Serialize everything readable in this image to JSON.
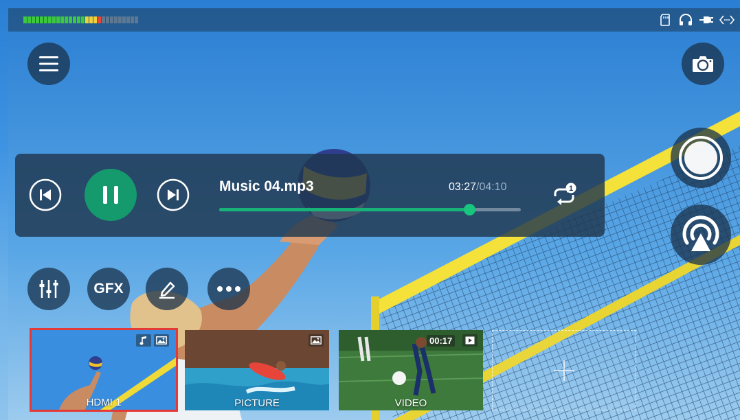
{
  "status_bar": {
    "audio_meter": {
      "level_fraction": 0.68,
      "colors": {
        "green": "#3ec83e",
        "yellow": "#f2d23a",
        "red": "#e8463a",
        "off": "#5f7891"
      }
    },
    "icons": [
      "sd-card-icon",
      "headphones-icon",
      "power-plug-icon",
      "network-arrows-icon"
    ]
  },
  "buttons": {
    "menu": "menu-icon",
    "camera": "camera-icon",
    "record": "record-icon",
    "live": "live-broadcast-icon",
    "mixer": "mixer-icon",
    "gfx_label": "GFX",
    "annotate": "pen-icon",
    "more": "more-dots-icon"
  },
  "music_player": {
    "title": "Music 04.mp3",
    "current_time": "03:27",
    "separator": "/",
    "total_time": "04:10",
    "progress_fraction": 0.829,
    "repeat_count": "1",
    "accent_color": "#149a6c"
  },
  "sources": [
    {
      "label": "HDMI 1",
      "selected": true,
      "badges": [
        "music-note-icon",
        "image-icon"
      ]
    },
    {
      "label": "PICTURE",
      "selected": false,
      "badges": [
        "image-icon"
      ]
    },
    {
      "label": "VIDEO",
      "selected": false,
      "duration": "00:17",
      "badges": [
        "play-icon"
      ]
    },
    {
      "label": "",
      "kind": "add",
      "icon": "plus-icon"
    }
  ]
}
